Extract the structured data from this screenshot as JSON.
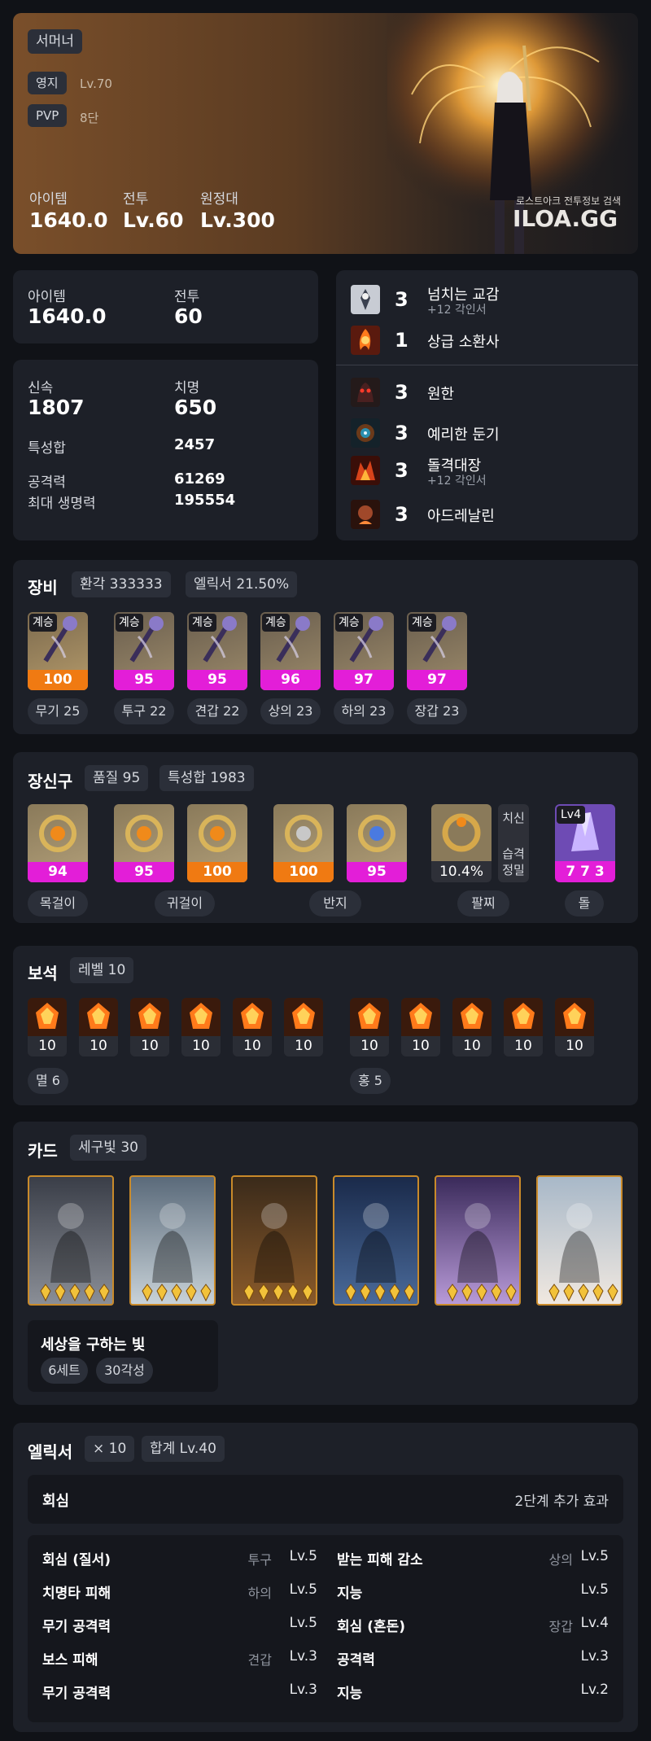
{
  "colors": {
    "bg": "#101217",
    "panel": "#1d2028",
    "chip": "#2b2f39",
    "orange": "#f07a12",
    "magenta": "#e31ed8",
    "muted": "#8f949e"
  },
  "hero": {
    "class_tag": "서머너",
    "estate_label": "영지",
    "estate_value": "Lv.70",
    "pvp_label": "PVP",
    "pvp_value": "8단",
    "item_label": "아이템",
    "item_value": "1640.0",
    "combat_label": "전투",
    "combat_value": "Lv.60",
    "expedition_label": "원정대",
    "expedition_value": "Lv.300",
    "watermark_sub": "로스트아크 전투정보 검색",
    "watermark": "ILOA.GG"
  },
  "levels": {
    "item_label": "아이템",
    "item_value": "1640.0",
    "combat_label": "전투",
    "combat_value": "60"
  },
  "stats": {
    "swift_label": "신속",
    "swift_value": "1807",
    "crit_label": "치명",
    "crit_value": "650",
    "total_label": "특성합",
    "total_value": "2457",
    "atk_label": "공격력",
    "atk_value": "61269",
    "hp_label": "최대 생명력",
    "hp_value": "195554"
  },
  "engravings": {
    "top": [
      {
        "icon": "overflowing-communion-icon",
        "level": "3",
        "name": "넘치는 교감",
        "sub": "+12 각인서"
      },
      {
        "icon": "elite-summoner-icon",
        "level": "1",
        "name": "상급 소환사",
        "sub": ""
      }
    ],
    "bottom": [
      {
        "icon": "grudge-icon",
        "level": "3",
        "name": "원한",
        "sub": ""
      },
      {
        "icon": "keen-blunt-weapon-icon",
        "level": "3",
        "name": "예리한 둔기",
        "sub": ""
      },
      {
        "icon": "raid-captain-icon",
        "level": "3",
        "name": "돌격대장",
        "sub": "+12 각인서"
      },
      {
        "icon": "adrenaline-icon",
        "level": "3",
        "name": "아드레날린",
        "sub": ""
      }
    ]
  },
  "equipment": {
    "title": "장비",
    "transcend": "환각 333333",
    "elixir": "엘릭서 21.50%",
    "items": [
      {
        "icon": "weapon-staff-icon",
        "tag": "계승",
        "quality": "100",
        "label": "무기 25",
        "bar": "orange"
      },
      {
        "icon": "helmet-icon",
        "tag": "계승",
        "quality": "95",
        "label": "투구 22",
        "bar": "magenta"
      },
      {
        "icon": "shoulder-icon",
        "tag": "계승",
        "quality": "95",
        "label": "견갑 22",
        "bar": "magenta"
      },
      {
        "icon": "chest-armor-icon",
        "tag": "계승",
        "quality": "96",
        "label": "상의 23",
        "bar": "magenta"
      },
      {
        "icon": "pants-icon",
        "tag": "계승",
        "quality": "97",
        "label": "하의 23",
        "bar": "magenta"
      },
      {
        "icon": "gloves-icon",
        "tag": "계승",
        "quality": "97",
        "label": "장갑 23",
        "bar": "magenta"
      }
    ]
  },
  "accessories": {
    "title": "장신구",
    "quality": "품질 95",
    "stat_total": "특성합 1983",
    "items": [
      {
        "icon": "necklace-icon",
        "quality": "94",
        "bar": "magenta"
      },
      {
        "icon": "earring-icon",
        "quality": "95",
        "bar": "magenta"
      },
      {
        "icon": "earring-icon",
        "quality": "100",
        "bar": "orange"
      },
      {
        "icon": "ring-icon",
        "quality": "100",
        "bar": "orange"
      },
      {
        "icon": "ring-icon",
        "quality": "95",
        "bar": "magenta"
      }
    ],
    "bracelet": {
      "icon": "bracelet-icon",
      "value": "10.4%",
      "opt1": "치신",
      "opt2": "습격",
      "opt3": "정밀"
    },
    "stone": {
      "icon": "ability-stone-icon",
      "level": "Lv4",
      "value": "7 7 3"
    },
    "labels": {
      "necklace": "목걸이",
      "earring": "귀걸이",
      "ring": "반지",
      "bracelet": "팔찌",
      "stone": "돌"
    }
  },
  "gems": {
    "title": "보석",
    "level": "레벨 10",
    "left": [
      "10",
      "10",
      "10",
      "10",
      "10",
      "10"
    ],
    "right": [
      "10",
      "10",
      "10",
      "10",
      "10"
    ],
    "left_label": "멸 6",
    "right_label": "홍 5"
  },
  "cards": {
    "title": "카드",
    "set_chip": "세구빛 30",
    "items": [
      {
        "icon": "card-knight-icon"
      },
      {
        "icon": "card-elder-icon"
      },
      {
        "icon": "card-demon-icon"
      },
      {
        "icon": "card-dark-army-icon"
      },
      {
        "icon": "card-twins-icon"
      },
      {
        "icon": "card-angel-icon"
      }
    ],
    "set_name": "세상을 구하는 빛",
    "set_count": "6세트",
    "awaken": "30각성"
  },
  "elixir": {
    "title": "엘릭서",
    "multiplier": "× 10",
    "total": "합계 Lv.40",
    "set_name": "회심",
    "set_effect": "2단계 추가 효과",
    "rows": [
      {
        "left_name": "회심 (질서)",
        "left_src": "투구",
        "left_lv": "Lv.5",
        "right_name": "받는 피해 감소",
        "right_src": "상의",
        "right_lv": "Lv.5"
      },
      {
        "left_name": "치명타 피해",
        "left_src": "하의",
        "left_lv": "Lv.5",
        "right_name": "지능",
        "right_src": "",
        "right_lv": "Lv.5"
      },
      {
        "left_name": "무기 공격력",
        "left_src": "",
        "left_lv": "Lv.5",
        "right_name": "회심 (혼돈)",
        "right_src": "장갑",
        "right_lv": "Lv.4"
      },
      {
        "left_name": "보스 피해",
        "left_src": "견갑",
        "left_lv": "Lv.3",
        "right_name": "공격력",
        "right_src": "",
        "right_lv": "Lv.3"
      },
      {
        "left_name": "무기 공격력",
        "left_src": "",
        "left_lv": "Lv.3",
        "right_name": "지능",
        "right_src": "",
        "right_lv": "Lv.2"
      }
    ]
  }
}
